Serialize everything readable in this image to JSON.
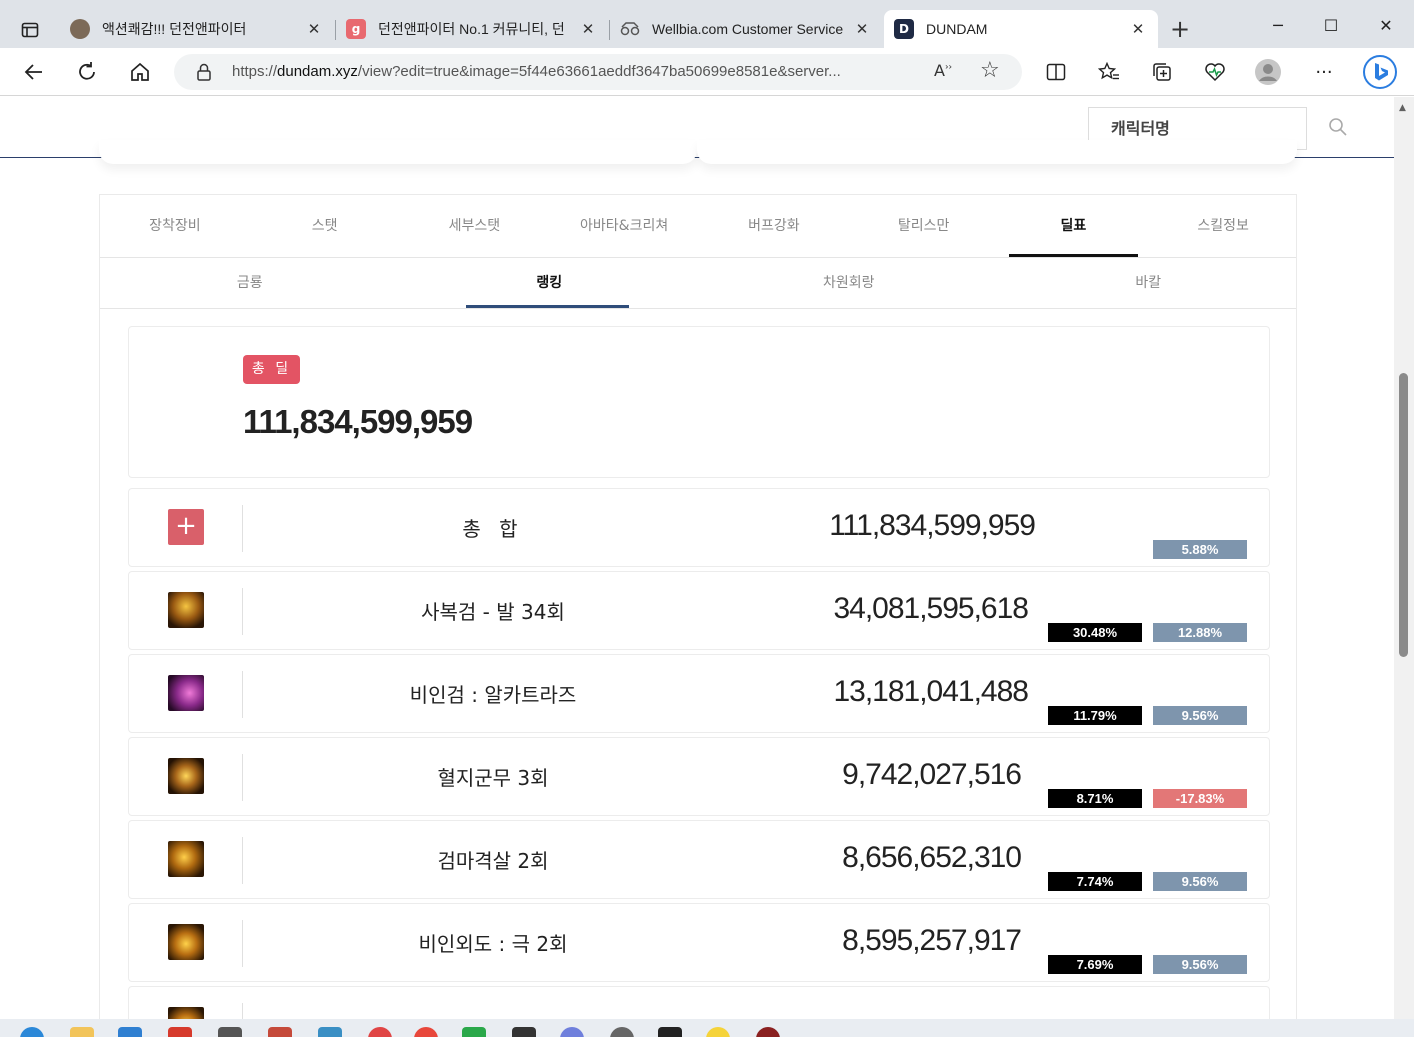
{
  "browser": {
    "tabs": [
      {
        "title": "액션쾌감!!! 던전앤파이터",
        "active": false,
        "favicon_color": "#7c6a58"
      },
      {
        "title": "던전앤파이터 No.1 커뮤니티, 던",
        "active": false,
        "favicon_color": "#e8696f",
        "favicon_letter": "g"
      },
      {
        "title": "Wellbia.com Customer Service",
        "active": false,
        "favicon_color": "#777777"
      },
      {
        "title": "DUNDAM",
        "active": true,
        "favicon_color": "#1f2a44",
        "favicon_letter": "D"
      }
    ],
    "url_prefix": "https://",
    "url_host": "dundam.xyz",
    "url_rest": "/view?edit=true&image=5f44e63661aeddf3647ba50699e8581e&server..."
  },
  "header": {
    "search_placeholder": "캐릭터명"
  },
  "main_tabs": [
    "장착장비",
    "스탯",
    "세부스탯",
    "아바타&크리쳐",
    "버프강화",
    "탈리스만",
    "딜표",
    "스킬정보"
  ],
  "main_tab_active": "딜표",
  "sub_tabs": [
    "금룡",
    "랭킹",
    "차원회랑",
    "바칼"
  ],
  "sub_tab_active": "랭킹",
  "total": {
    "badge": "총 딜",
    "value": "111,834,599,959"
  },
  "rows": [
    {
      "name": "총 합",
      "damage": "111,834,599,959",
      "pct_share": "",
      "pct_change": "5.88%",
      "change_negative": false,
      "icon": "plus-icon"
    },
    {
      "name": "사복검 - 발 34회",
      "damage": "34,081,595,618",
      "pct_share": "30.48%",
      "pct_change": "12.88%",
      "change_negative": false,
      "icon": "skill-icon"
    },
    {
      "name": "비인검 : 알카트라즈",
      "damage": "13,181,041,488",
      "pct_share": "11.79%",
      "pct_change": "9.56%",
      "change_negative": false,
      "icon": "skill-icon"
    },
    {
      "name": "혈지군무 3회",
      "damage": "9,742,027,516",
      "pct_share": "8.71%",
      "pct_change": "-17.83%",
      "change_negative": true,
      "icon": "skill-icon"
    },
    {
      "name": "검마격살 2회",
      "damage": "8,656,652,310",
      "pct_share": "7.74%",
      "pct_change": "9.56%",
      "change_negative": false,
      "icon": "skill-icon"
    },
    {
      "name": "비인외도 : 극 2회",
      "damage": "8,595,257,917",
      "pct_share": "7.69%",
      "pct_change": "9.56%",
      "change_negative": false,
      "icon": "skill-icon"
    }
  ],
  "colors": {
    "accent_navy": "#2f4d7a",
    "badge_red": "#e35464",
    "pct_blue": "#7e95ad",
    "pct_red": "#e37777"
  }
}
